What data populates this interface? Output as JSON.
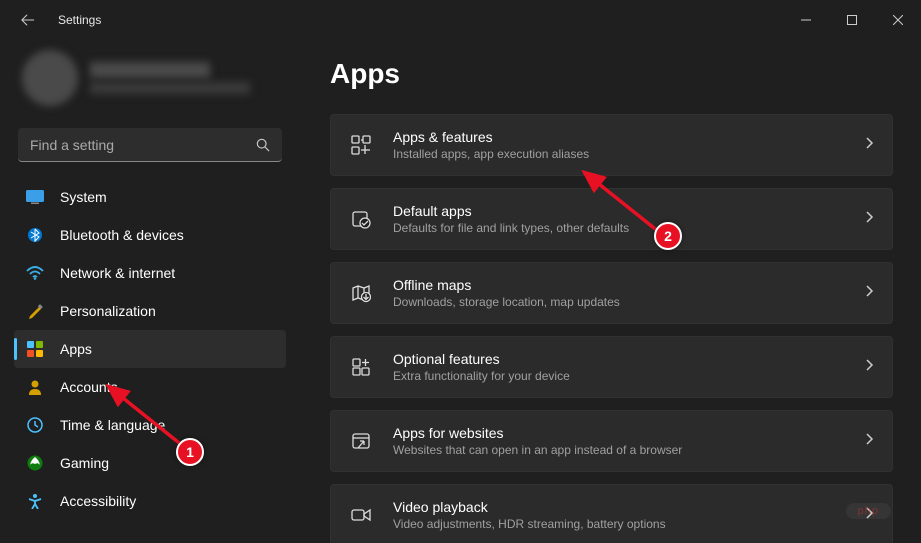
{
  "titlebar": {
    "app_title": "Settings"
  },
  "search": {
    "placeholder": "Find a setting"
  },
  "sidebar": {
    "items": [
      {
        "label": "System",
        "icon": "system-icon",
        "active": false
      },
      {
        "label": "Bluetooth & devices",
        "icon": "bluetooth-icon",
        "active": false
      },
      {
        "label": "Network & internet",
        "icon": "wifi-icon",
        "active": false
      },
      {
        "label": "Personalization",
        "icon": "personalization-icon",
        "active": false
      },
      {
        "label": "Apps",
        "icon": "apps-nav-icon",
        "active": true
      },
      {
        "label": "Accounts",
        "icon": "accounts-icon",
        "active": false
      },
      {
        "label": "Time & language",
        "icon": "time-icon",
        "active": false
      },
      {
        "label": "Gaming",
        "icon": "gaming-icon",
        "active": false
      },
      {
        "label": "Accessibility",
        "icon": "accessibility-icon",
        "active": false
      }
    ]
  },
  "page": {
    "title": "Apps"
  },
  "cards": [
    {
      "title": "Apps & features",
      "sub": "Installed apps, app execution aliases",
      "icon": "apps-features-icon"
    },
    {
      "title": "Default apps",
      "sub": "Defaults for file and link types, other defaults",
      "icon": "default-apps-icon"
    },
    {
      "title": "Offline maps",
      "sub": "Downloads, storage location, map updates",
      "icon": "offline-maps-icon"
    },
    {
      "title": "Optional features",
      "sub": "Extra functionality for your device",
      "icon": "optional-features-icon"
    },
    {
      "title": "Apps for websites",
      "sub": "Websites that can open in an app instead of a browser",
      "icon": "apps-websites-icon"
    },
    {
      "title": "Video playback",
      "sub": "Video adjustments, HDR streaming, battery options",
      "icon": "video-playback-icon"
    }
  ],
  "annotations": {
    "badge1": "1",
    "badge2": "2"
  },
  "watermark": "php"
}
